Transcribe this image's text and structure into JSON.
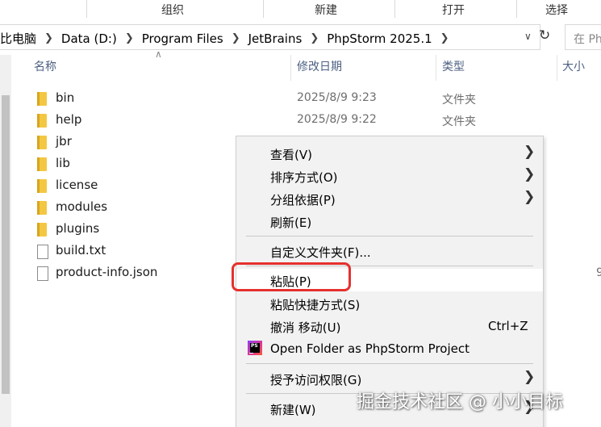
{
  "ribbon": {
    "groups": [
      "组织",
      "新建",
      "打开",
      "选择"
    ]
  },
  "address": {
    "crumbs": [
      "比电脑",
      "Data (D:)",
      "Program Files",
      "JetBrains",
      "PhpStorm 2025.1"
    ],
    "search_placeholder": "在 Ph"
  },
  "columns": {
    "name": "名称",
    "modified": "修改日期",
    "type": "类型",
    "size": "大小"
  },
  "files": [
    {
      "name": "bin",
      "date": "2025/8/9 9:23",
      "type": "文件夹",
      "kind": "folder"
    },
    {
      "name": "help",
      "date": "2025/8/9 9:22",
      "type": "文件夹",
      "kind": "folder"
    },
    {
      "name": "jbr",
      "date": "",
      "type": "",
      "kind": "folder"
    },
    {
      "name": "lib",
      "date": "",
      "type": "",
      "kind": "folder"
    },
    {
      "name": "license",
      "date": "",
      "type": "",
      "kind": "folder"
    },
    {
      "name": "modules",
      "date": "",
      "type": "",
      "kind": "folder"
    },
    {
      "name": "plugins",
      "date": "",
      "type": "",
      "kind": "folder"
    },
    {
      "name": "build.txt",
      "date": "",
      "type": "",
      "kind": "file"
    },
    {
      "name": "product-info.json",
      "date": "",
      "type": "",
      "kind": "file"
    }
  ],
  "size_fragment": "9",
  "context_menu": {
    "items": [
      {
        "label": "查看(V)",
        "submenu": true
      },
      {
        "label": "排序方式(O)",
        "submenu": true
      },
      {
        "label": "分组依据(P)",
        "submenu": true
      },
      {
        "label": "刷新(E)"
      },
      {
        "label": "自定义文件夹(F)..."
      },
      {
        "label": "粘贴(P)",
        "highlighted": true
      },
      {
        "label": "粘贴快捷方式(S)"
      },
      {
        "label": "撤消 移动(U)",
        "shortcut": "Ctrl+Z"
      },
      {
        "label": "Open Folder as PhpStorm Project",
        "icon": "phpstorm-icon"
      },
      {
        "label": "授予访问权限(G)",
        "submenu": true
      },
      {
        "label": "新建(W)",
        "submenu": true
      }
    ]
  },
  "icon_text": {
    "phpstorm": "PS"
  },
  "watermark": "掘金技术社区 @ 小小目标",
  "colors": {
    "highlight_ring": "#e5312e",
    "folder": "#f4c742",
    "header_text": "#4d6082"
  }
}
